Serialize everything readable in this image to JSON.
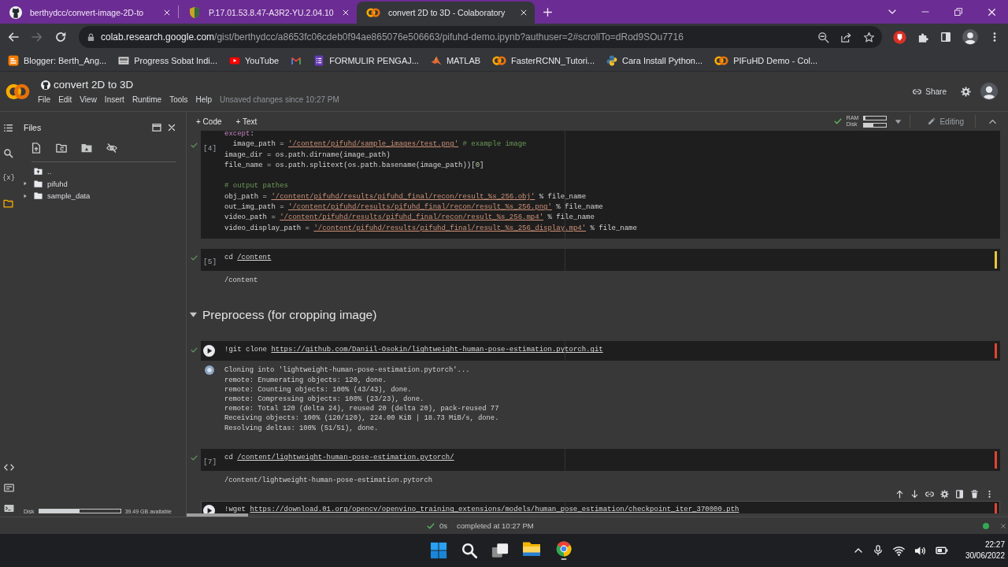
{
  "browser": {
    "tabs": [
      {
        "title": "berthydcc/convert-image-2D-to",
        "selected": false
      },
      {
        "title": "P.17.01.53.8.47-A3R2-YU.2.04.10",
        "selected": false
      },
      {
        "title": "convert 2D to 3D - Colaboratory",
        "selected": true
      }
    ],
    "nav": {
      "forward_disabled": true
    },
    "address": {
      "host": "colab.research.google.com",
      "path": "/gist/berthydcc/a8653fc06cdeb0f94ae865076e506663/pifuhd-demo.ipynb?authuser=2#scrollTo=dRod9SOu7716"
    },
    "bookmarks": [
      {
        "kind": "labeled",
        "label": "Blogger: Berth_Ang..."
      },
      {
        "kind": "labeled",
        "label": "Progress Sobat Indi..."
      },
      {
        "kind": "labeled",
        "label": "YouTube"
      },
      {
        "kind": "icon"
      },
      {
        "kind": "labeled",
        "label": "FORMULIR PENGAJ..."
      },
      {
        "kind": "labeled",
        "label": "MATLAB"
      },
      {
        "kind": "labeled",
        "label": "FasterRCNN_Tutori..."
      },
      {
        "kind": "labeled",
        "label": "Cara Install Python..."
      },
      {
        "kind": "labeled",
        "label": "PIFuHD Demo - Col..."
      }
    ]
  },
  "colab": {
    "title": "convert 2D to 3D",
    "menu": [
      "File",
      "Edit",
      "View",
      "Insert",
      "Runtime",
      "Tools",
      "Help"
    ],
    "save_status": "Unsaved changes since 10:27 PM",
    "share": "Share",
    "sidebar": {
      "rail": [
        {
          "selected": false
        },
        {
          "selected": false
        },
        {
          "selected": false,
          "glyph": "{x}"
        },
        {
          "selected": true
        }
      ],
      "title": "Files",
      "parent_entry": "..",
      "tree": [
        {
          "name": "pifuhd",
          "expanded": false
        },
        {
          "name": "sample_data",
          "expanded": false
        }
      ],
      "disk": {
        "label": "Disk",
        "level": 0.5,
        "reading": "39.49 GB available"
      }
    },
    "toolbar": {
      "add_buttons": [
        "+ Code",
        "+ Text"
      ],
      "resources": [
        {
          "label": "RAM",
          "level": 0.05
        },
        {
          "label": "Disk",
          "level": 0.42
        }
      ],
      "mode": "Editing"
    },
    "cells": [
      {
        "kind": "code",
        "count": "[4]",
        "hovered": false,
        "done": true,
        "selected": false,
        "blocks": [
          [
            [
              {
                "kind": "keyword",
                "text": "except"
              },
              {
                "kind": "plain",
                "text": ":"
              }
            ],
            [
              {
                "kind": "plain",
                "text": "  image_path = "
              },
              {
                "kind": "string",
                "text": "'/content/pifuhd/sample_images/test.png'"
              },
              {
                "kind": "comment",
                "text": " # example image"
              }
            ],
            [
              {
                "kind": "plain",
                "text": "image_dir = os.path.dirname(image_path)"
              }
            ],
            [
              {
                "kind": "plain",
                "text": "file_name = os.path.splitext(os.path.basename(image_path))["
              },
              {
                "kind": "number",
                "text": "0"
              },
              {
                "kind": "plain",
                "text": "]"
              }
            ]
          ],
          [
            [
              {
                "kind": "comment",
                "text": "# output pathes"
              }
            ],
            [
              {
                "kind": "plain",
                "text": "obj_path = "
              },
              {
                "kind": "string",
                "text": "'/content/pifuhd/results/pifuhd_final/recon/result_%s_256.obj'"
              },
              {
                "kind": "plain",
                "text": " % file_name"
              }
            ],
            [
              {
                "kind": "plain",
                "text": "out_img_path = "
              },
              {
                "kind": "string",
                "text": "'/content/pifuhd/results/pifuhd_final/recon/result_%s_256.png'"
              },
              {
                "kind": "plain",
                "text": " % file_name"
              }
            ],
            [
              {
                "kind": "plain",
                "text": "video_path = "
              },
              {
                "kind": "string",
                "text": "'/content/pifuhd/results/pifuhd_final/recon/result_%s_256.mp4'"
              },
              {
                "kind": "plain",
                "text": " % file_name"
              }
            ],
            [
              {
                "kind": "plain",
                "text": "video_display_path = "
              },
              {
                "kind": "string",
                "text": "'/content/pifuhd/results/pifuhd_final/result_%s_256_display.mp4'"
              },
              {
                "kind": "plain",
                "text": " % file_name"
              }
            ]
          ]
        ]
      },
      {
        "kind": "code",
        "count": "[5]",
        "hovered": false,
        "done": true,
        "selected": false,
        "color": "#e8c43a",
        "blocks": [
          [
            [
              {
                "kind": "plain",
                "text": "cd "
              },
              {
                "kind": "path",
                "text": "/content"
              }
            ]
          ]
        ],
        "output": {
          "lines": [
            "/content"
          ]
        }
      },
      {
        "kind": "heading",
        "text": "Preprocess (for cropping image)",
        "expanded": true
      },
      {
        "kind": "code",
        "hovered": true,
        "done": true,
        "selected": false,
        "color": "#e0452f",
        "blocks": [
          [
            [
              {
                "kind": "plain",
                "text": "!git clone "
              },
              {
                "kind": "path",
                "text": "https://github.com/Daniil-Osokin/lightweight-human-pose-estimation.pytorch.git"
              }
            ]
          ]
        ],
        "output": {
          "clear_icon": true,
          "lines": [
            "Cloning into 'lightweight-human-pose-estimation.pytorch'...",
            "remote: Enumerating objects: 120, done.",
            "remote: Counting objects: 100% (43/43), done.",
            "remote: Compressing objects: 100% (23/23), done.",
            "remote: Total 120 (delta 24), reused 20 (delta 20), pack-reused 77",
            "Receiving objects: 100% (120/120), 224.00 KiB | 18.73 MiB/s, done.",
            "Resolving deltas: 100% (51/51), done."
          ]
        }
      },
      {
        "kind": "code",
        "count": "[7]",
        "hovered": false,
        "done": true,
        "selected": false,
        "color": "#e0452f",
        "blocks": [
          [
            [
              {
                "kind": "plain",
                "text": "cd "
              },
              {
                "kind": "path",
                "text": "/content/lightweight-human-pose-estimation.pytorch/"
              }
            ]
          ]
        ],
        "output": {
          "lines": [
            "/content/lightweight-human-pose-estimation.pytorch"
          ]
        }
      },
      {
        "kind": "code",
        "hovered": true,
        "done": false,
        "selected": true,
        "color": "#e0452f",
        "blocks": [
          [
            [
              {
                "kind": "plain",
                "text": "!wget "
              },
              {
                "kind": "path",
                "text": "https://download.01.org/opencv/openvino_training_extensions/models/human_pose_estimation/checkpoint_iter_370000.pth"
              }
            ]
          ]
        ]
      }
    ],
    "status": {
      "duration": "0s",
      "message": "completed at 10:27 PM",
      "connected": true
    }
  },
  "taskbar": {
    "apps": [
      {
        "running": false
      },
      {
        "running": true
      }
    ],
    "time": "22:27",
    "date": "30/06/2022"
  }
}
